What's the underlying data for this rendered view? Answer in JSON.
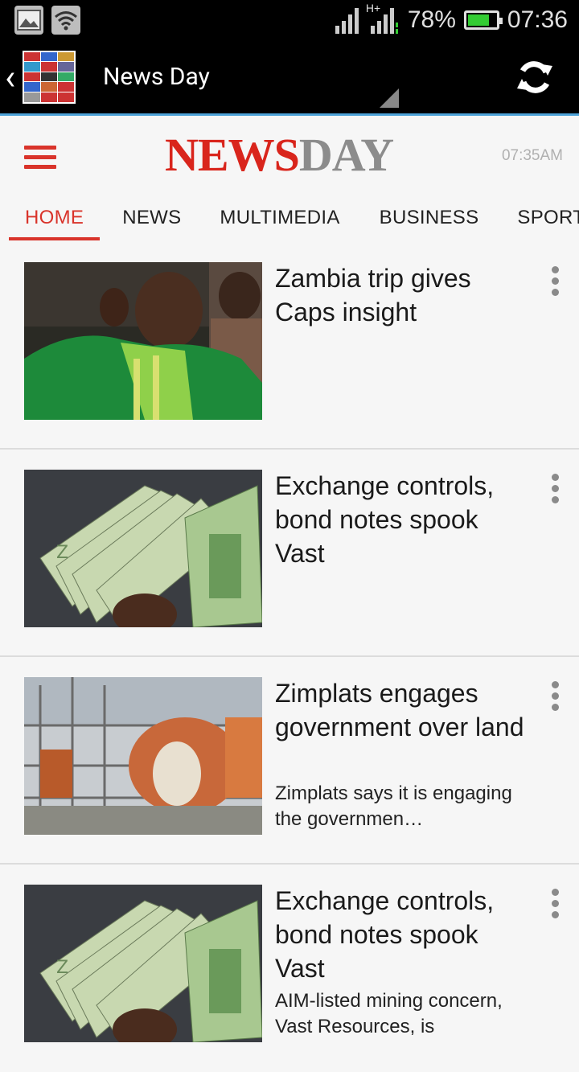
{
  "status_bar": {
    "network": "H+",
    "battery": "78%",
    "battery_level": 0.78,
    "time": "07:36"
  },
  "app_bar": {
    "title": "News Day"
  },
  "site": {
    "brand_news": "NEWS",
    "brand_day": "DAY",
    "time": "07:35AM"
  },
  "tabs": [
    {
      "label": "HOME"
    },
    {
      "label": "NEWS"
    },
    {
      "label": "MULTIMEDIA"
    },
    {
      "label": "BUSINESS"
    },
    {
      "label": "SPORT"
    }
  ],
  "articles": [
    {
      "title": "Zambia trip gives Caps insight",
      "summary": ""
    },
    {
      "title": "Exchange controls, bond notes spook Vast",
      "summary": ""
    },
    {
      "title": "Zimplats engages government over land",
      "summary": "Zimplats says it is engaging the governmen…"
    },
    {
      "title": "Exchange controls, bond notes spook Vast",
      "summary": "AIM-listed mining concern, Vast Resources, is"
    }
  ]
}
